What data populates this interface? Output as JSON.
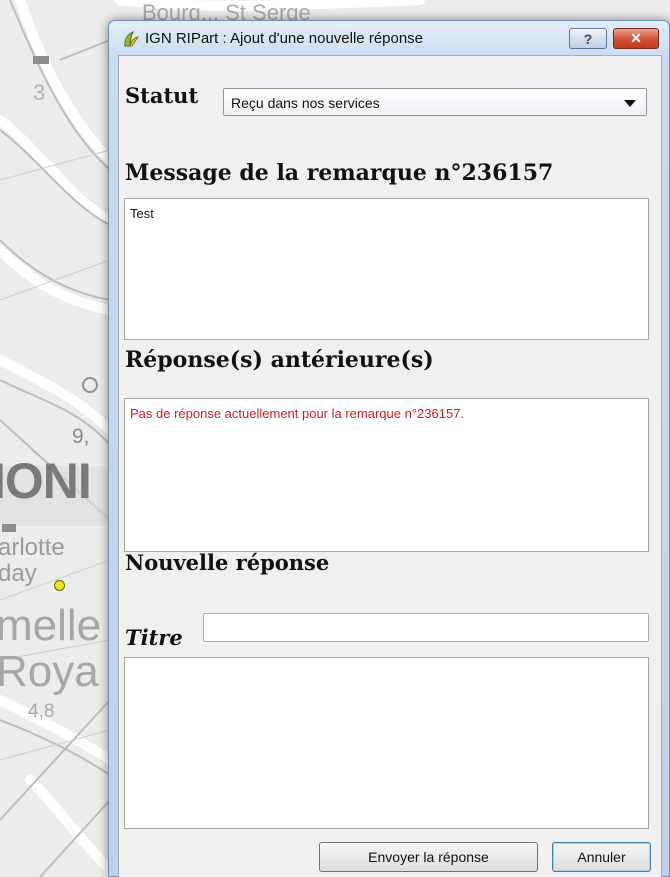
{
  "map": {
    "labels": {
      "top_text": "Bourg... St Serge",
      "num_3": "3",
      "num_9": "9,",
      "big_ion": "IONI",
      "charlotte": "arlotte",
      "day": "day",
      "melle": "melle",
      "roya": "Roya",
      "num_48": "4,8"
    }
  },
  "window": {
    "title": "IGN RIPart : Ajout d'une nouvelle réponse",
    "help_label": "?",
    "close_label": "✕"
  },
  "form": {
    "statut_label": "Statut",
    "statut_value": "Reçu dans nos services",
    "message_title": "Message de la remarque n°236157",
    "message_text": "Test",
    "previous_title": "Réponse(s) antérieure(s)",
    "previous_text": "Pas de réponse actuellement pour la remarque n°236157.",
    "new_title": "Nouvelle réponse",
    "titre_label": "Titre",
    "titre_value": "",
    "reply_value": ""
  },
  "buttons": {
    "send": "Envoyer la réponse",
    "cancel": "Annuler"
  },
  "colors": {
    "error_text": "#d21b1b",
    "title_bar": "#c8dbef",
    "close_button": "#d2553a"
  }
}
